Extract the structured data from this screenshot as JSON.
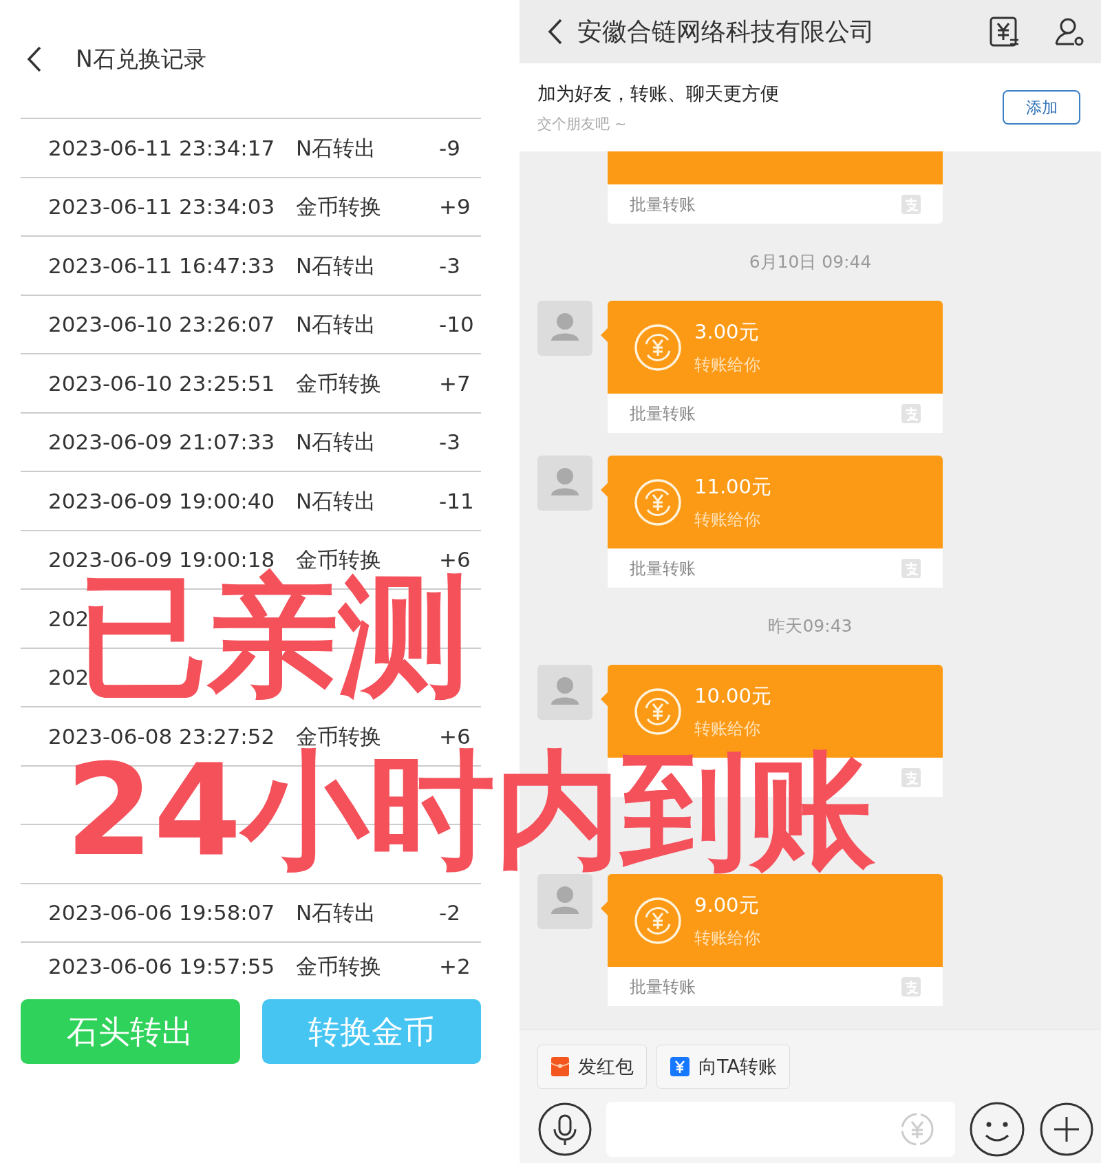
{
  "left": {
    "title": "N石兑换记录",
    "rows": [
      {
        "date": "2023-06-11 23:34:17",
        "type": "N石转出",
        "amount": "-9"
      },
      {
        "date": "2023-06-11 23:34:03",
        "type": "金币转换",
        "amount": "+9"
      },
      {
        "date": "2023-06-11 16:47:33",
        "type": "N石转出",
        "amount": "-3"
      },
      {
        "date": "2023-06-10 23:26:07",
        "type": "N石转出",
        "amount": "-10"
      },
      {
        "date": "2023-06-10 23:25:51",
        "type": "金币转换",
        "amount": "+7"
      },
      {
        "date": "2023-06-09 21:07:33",
        "type": "N石转出",
        "amount": "-3"
      },
      {
        "date": "2023-06-09 19:00:40",
        "type": "N石转出",
        "amount": "-11"
      },
      {
        "date": "2023-06-09 19:00:18",
        "type": "金币转换",
        "amount": "+6"
      },
      {
        "date": "202"
      },
      {
        "date": "202"
      },
      {
        "date": "2023-06-08 23:27:52",
        "type": "金币转换",
        "amount": "+6"
      },
      {},
      {},
      {
        "date": "2023-06-06 19:58:07",
        "type": "N石转出",
        "amount": "-2"
      },
      {
        "date": "2023-06-06 19:57:55",
        "type": "金币转换",
        "amount": "+2"
      }
    ],
    "buttons": [
      {
        "label": "石头转出",
        "color": "#2fd25a"
      },
      {
        "label": "转换金币",
        "color": "#46c5f3"
      }
    ]
  },
  "right": {
    "title": "安徽合链网络科技有限公司",
    "banner": {
      "title": "加为好友，转账、聊天更方便",
      "subtitle": "交个朋友吧 ~",
      "button": "添加"
    },
    "messages": [
      {
        "kind": "card_partial",
        "footer": "批量转账"
      },
      {
        "kind": "time",
        "text": "6月10日 09:44"
      },
      {
        "kind": "card",
        "amount": "3.00元",
        "note": "转账给你",
        "footer": "批量转账"
      },
      {
        "kind": "card",
        "amount": "11.00元",
        "note": "转账给你",
        "footer": "批量转账"
      },
      {
        "kind": "time",
        "text": "昨天09:43"
      },
      {
        "kind": "card",
        "amount": "10.00元",
        "note": "转账给你"
      },
      {
        "kind": "time"
      },
      {
        "kind": "card",
        "amount": "9.00元",
        "note": "转账给你",
        "footer": "批量转账"
      }
    ],
    "quick_actions": [
      {
        "label": "发红包",
        "kind": "red_packet"
      },
      {
        "label": "向TA转账",
        "kind": "transfer"
      }
    ]
  },
  "overlay": {
    "lines": [
      "已亲测",
      "24小时内到账"
    ]
  }
}
